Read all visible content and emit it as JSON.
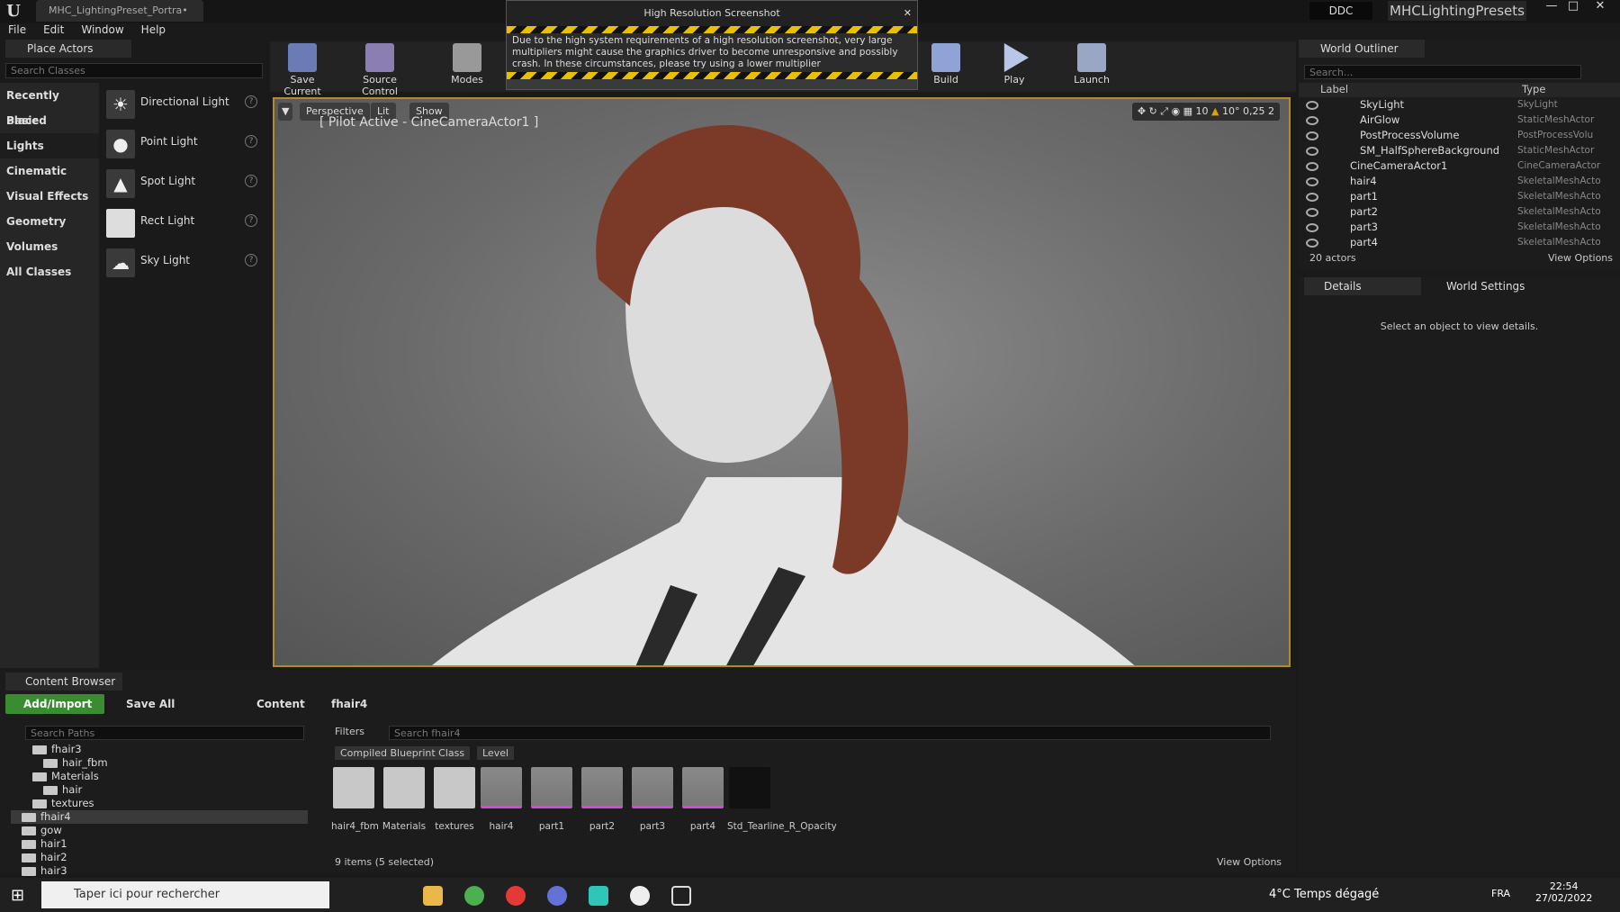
{
  "window": {
    "doc_tab": "MHC_LightingPreset_Portra•",
    "ddc": "DDC",
    "project": "MHCLightingPresets"
  },
  "menu": [
    "File",
    "Edit",
    "Window",
    "Help"
  ],
  "place_actors": {
    "tab": "Place Actors",
    "search_placeholder": "Search Classes",
    "categories": [
      "Recently Placed",
      "Basic",
      "Lights",
      "Cinematic",
      "Visual Effects",
      "Geometry",
      "Volumes",
      "All Classes"
    ],
    "selected_category": "Lights",
    "items": [
      "Directional Light",
      "Point Light",
      "Spot Light",
      "Rect Light",
      "Sky Light"
    ]
  },
  "toolbar": {
    "save_current": "Save Current",
    "source_control": "Source Control",
    "modes": "Modes",
    "build": "Build",
    "play": "Play",
    "launch": "Launch"
  },
  "viewport": {
    "perspective": "Perspective",
    "lit": "Lit",
    "show": "Show",
    "pilot": "[ Pilot Active - CineCameraActor1 ]",
    "grid": "10",
    "angle": "10°",
    "scale": "0,25",
    "cam_speed": "2"
  },
  "dialog": {
    "title": "High Resolution Screenshot",
    "text": "Due to the high system requirements of a high resolution screenshot, very large multipliers might cause the graphics driver to become unresponsive and possibly crash. In these circumstances, please try using a lower multiplier"
  },
  "outliner": {
    "tab": "World Outliner",
    "search_placeholder": "Search...",
    "col_label": "Label",
    "col_type": "Type",
    "rows": [
      {
        "label": "SkyLight",
        "type": "SkyLight"
      },
      {
        "label": "AirGlow",
        "type": "StaticMeshActor"
      },
      {
        "label": "PostProcessVolume",
        "type": "PostProcessVolu"
      },
      {
        "label": "SM_HalfSphereBackground",
        "type": "StaticMeshActor"
      },
      {
        "label": "CineCameraActor1",
        "type": "CineCameraActor"
      },
      {
        "label": "hair4",
        "type": "SkeletalMeshActo"
      },
      {
        "label": "part1",
        "type": "SkeletalMeshActo"
      },
      {
        "label": "part2",
        "type": "SkeletalMeshActo"
      },
      {
        "label": "part3",
        "type": "SkeletalMeshActo"
      },
      {
        "label": "part4",
        "type": "SkeletalMeshActo"
      }
    ],
    "count": "20 actors",
    "view_options": "View Options"
  },
  "details": {
    "tab1": "Details",
    "tab2": "World Settings",
    "empty": "Select an object to view details."
  },
  "content_browser": {
    "tab": "Content Browser",
    "add_import": "Add/Import",
    "save_all": "Save All",
    "crumb1": "Content",
    "crumb2": "fhair4",
    "search_paths": "Search Paths",
    "filters": "Filters",
    "search_assets": "Search fhair4",
    "filter_chips": [
      "Compiled Blueprint Class",
      "Level"
    ],
    "tree": [
      "fhair3",
      "hair_fbm",
      "Materials",
      "hair",
      "textures",
      "fhair4",
      "gow",
      "hair1",
      "hair2",
      "hair3"
    ],
    "assets": [
      "hair4_fbm",
      "Materials",
      "textures",
      "hair4",
      "part1",
      "part2",
      "part3",
      "part4",
      "Std_Tearline_R_Opacity"
    ],
    "status": "9 items (5 selected)",
    "view_options": "View Options"
  },
  "taskbar": {
    "search": "Taper ici pour rechercher",
    "weather": "4°C  Temps dégagé",
    "lang": "FRA",
    "time": "22:54",
    "date": "27/02/2022"
  }
}
